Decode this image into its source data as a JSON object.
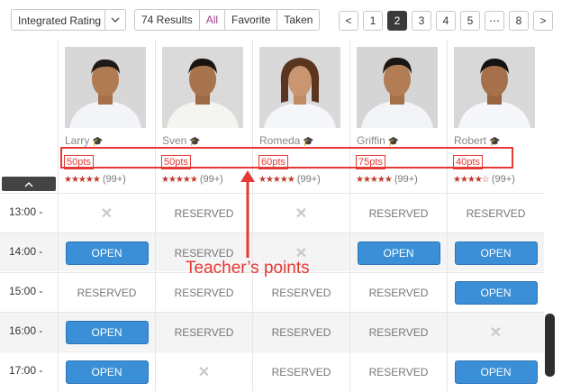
{
  "toolbar": {
    "sort_value": "Integrated Rating",
    "results_label": "74 Results",
    "filter_tabs": [
      "All",
      "Favorite",
      "Taken"
    ],
    "pager": [
      "<",
      "1",
      "2",
      "3",
      "4",
      "5",
      "⋯",
      "8",
      ">"
    ],
    "current_page": "2"
  },
  "teachers": [
    {
      "name": "Larry",
      "points": "50pts",
      "rating_stars": "★★★★★",
      "reviews": "(99+)",
      "rating": 5
    },
    {
      "name": "Sven",
      "points": "50pts",
      "rating_stars": "★★★★★",
      "reviews": "(99+)",
      "rating": 5
    },
    {
      "name": "Romeda",
      "points": "60pts",
      "rating_stars": "★★★★★",
      "reviews": "(99+)",
      "rating": 5
    },
    {
      "name": "Griffin",
      "points": "75pts",
      "rating_stars": "★★★★★",
      "reviews": "(99+)",
      "rating": 5
    },
    {
      "name": "Robert",
      "points": "40pts",
      "rating_stars": "★★★★☆",
      "reviews": "(99+)",
      "rating": 4.5
    }
  ],
  "schedule": [
    {
      "time": "13:00 -",
      "slots": [
        "x",
        "RESERVED",
        "x",
        "RESERVED",
        "RESERVED"
      ]
    },
    {
      "time": "14:00 -",
      "slots": [
        "OPEN",
        "RESERVED",
        "x",
        "OPEN",
        "OPEN"
      ]
    },
    {
      "time": "15:00 -",
      "slots": [
        "RESERVED",
        "RESERVED",
        "RESERVED",
        "RESERVED",
        "OPEN"
      ]
    },
    {
      "time": "16:00 -",
      "slots": [
        "OPEN",
        "RESERVED",
        "RESERVED",
        "RESERVED",
        "x"
      ]
    },
    {
      "time": "17:00 -",
      "slots": [
        "OPEN",
        "x",
        "RESERVED",
        "RESERVED",
        "OPEN"
      ]
    }
  ],
  "annotation": {
    "label": "Teacher’s points",
    "color": "#e53935"
  },
  "colors": {
    "open": "#3b8fd6",
    "active_tab": "#a23c8c",
    "points": "#e53935",
    "stars": "#c0392b"
  },
  "icons": {
    "sort": "chevron-down-icon",
    "teacher": "graduation-cap-icon",
    "collapse": "chevron-up-icon",
    "unavailable": "x-mark-icon"
  }
}
